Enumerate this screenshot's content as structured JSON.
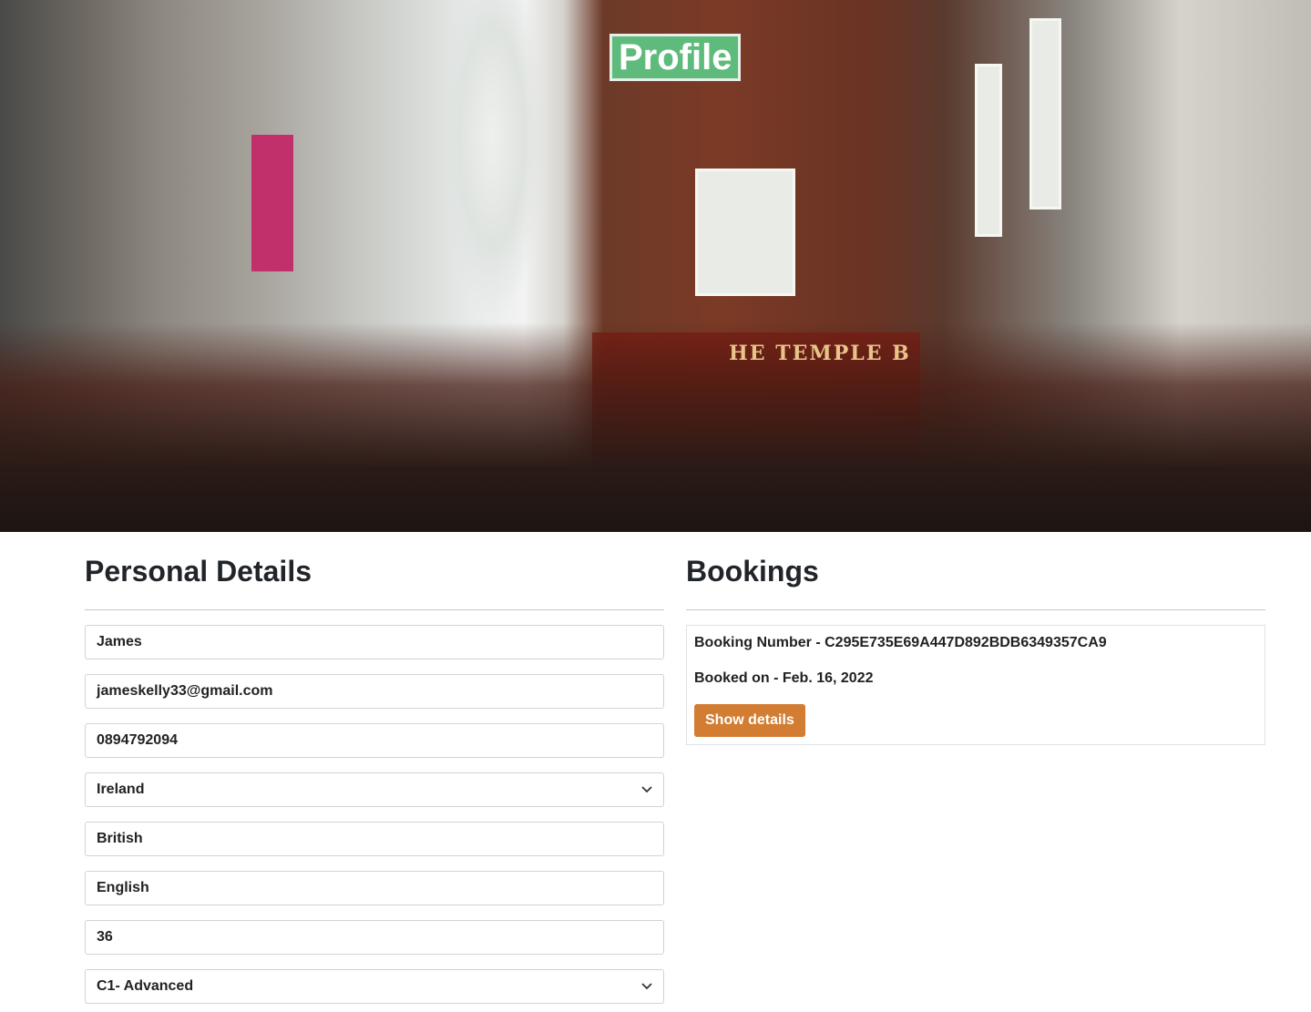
{
  "hero": {
    "title": "Profile",
    "sign_text": "HE TEMPLE B"
  },
  "personal": {
    "heading": "Personal Details",
    "fields": [
      {
        "name": "first-name",
        "value": "James",
        "type": "text"
      },
      {
        "name": "email",
        "value": "jameskelly33@gmail.com",
        "type": "text"
      },
      {
        "name": "phone",
        "value": "0894792094",
        "type": "text"
      },
      {
        "name": "country",
        "value": "Ireland",
        "type": "select"
      },
      {
        "name": "nationality",
        "value": "British",
        "type": "text"
      },
      {
        "name": "language",
        "value": "English",
        "type": "text"
      },
      {
        "name": "age",
        "value": "36",
        "type": "text"
      },
      {
        "name": "language-level",
        "value": "C1- Advanced",
        "type": "select"
      }
    ]
  },
  "bookings": {
    "heading": "Bookings",
    "items": [
      {
        "number_text": "Booking Number - C295E735E69A447D892BDB6349357CA9",
        "booked_text": "Booked on - Feb. 16, 2022",
        "button": "Show details"
      }
    ]
  },
  "colors": {
    "accent_green": "#5fbb7c",
    "button_orange": "#d27d32"
  }
}
